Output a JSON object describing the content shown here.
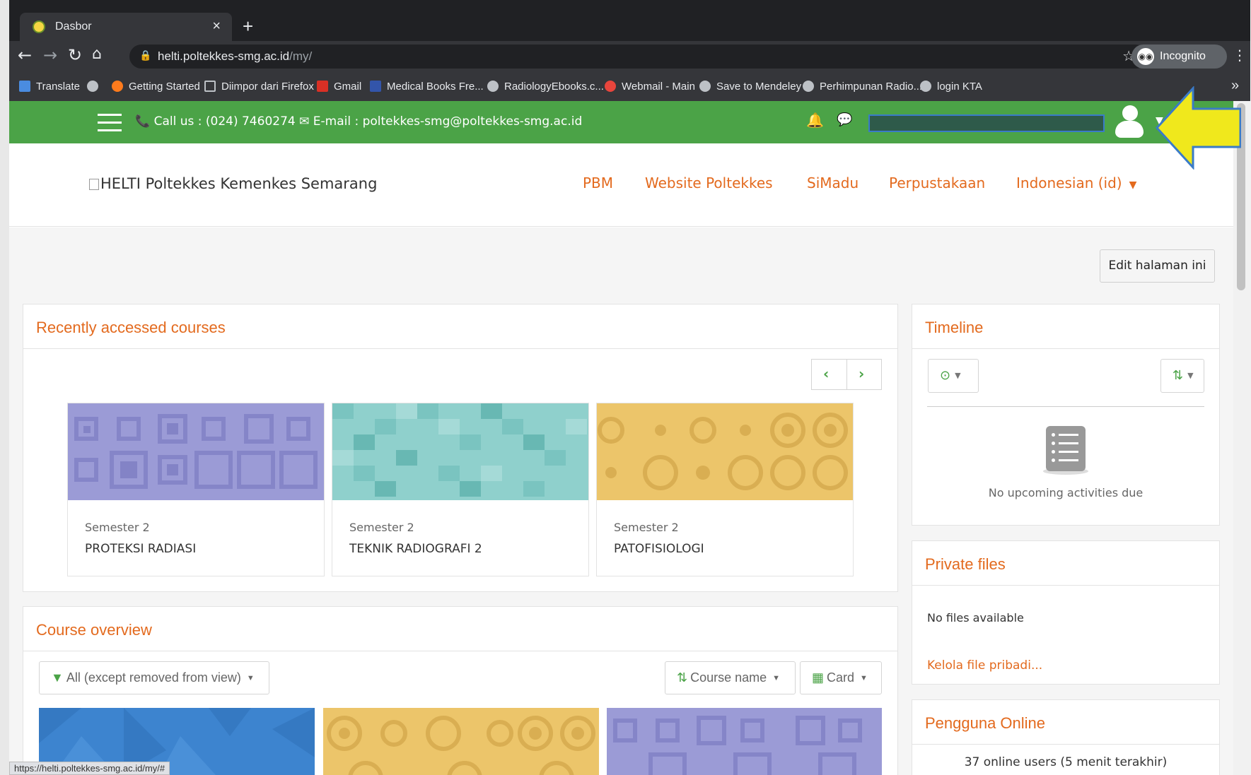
{
  "browser": {
    "tab_title": "Dasbor",
    "tab_close": "×",
    "new_tab": "+",
    "url_host": "helti.poltekkes-smg.ac.id",
    "url_path": "/my/",
    "incognito_label": "Incognito",
    "bookmarks": [
      "Translate",
      "Getting Started",
      "Diimpor dari Firefox",
      "Gmail",
      "Medical Books Fre...",
      "RadiologyEbooks.c...",
      "Webmail - Main",
      "Save to Mendeley",
      "Perhimpunan Radio...",
      "login KTA"
    ],
    "bookmarks_more": "»",
    "status_url": "https://helti.poltekkes-smg.ac.id/my/#"
  },
  "topbar": {
    "contact": "📞 Call us : (024) 7460274 ✉ E-mail : poltekkes-smg@poltekkes-smg.ac.id",
    "color": "#4ba347"
  },
  "header": {
    "logo_alt": "HELTI Poltekkes Kemenkes Semarang",
    "nav": [
      "PBM",
      "Website Poltekkes",
      "SiMadu",
      "Perpustakaan",
      "Indonesian (id)"
    ]
  },
  "page": {
    "edit_button": "Edit halaman ini"
  },
  "recent": {
    "title": "Recently accessed courses",
    "courses": [
      {
        "category": "Semester 2",
        "name": "PROTEKSI RADIASI",
        "pattern": "purple-squares"
      },
      {
        "category": "Semester 2",
        "name": "TEKNIK RADIOGRAFI 2",
        "pattern": "teal-grid"
      },
      {
        "category": "Semester 2",
        "name": "PATOFISIOLOGI",
        "pattern": "yellow-circles"
      }
    ]
  },
  "overview": {
    "title": "Course overview",
    "filter_label": "All (except removed from view)",
    "sort_label": "Course name",
    "view_label": "Card"
  },
  "timeline": {
    "title": "Timeline",
    "empty_text": "No upcoming activities due"
  },
  "private_files": {
    "title": "Private files",
    "empty_text": "No files available",
    "manage_link": "Kelola file pribadi..."
  },
  "online_users": {
    "title": "Pengguna Online",
    "text": "37 online users (5 menit terakhir)"
  },
  "colors": {
    "accent": "#e36a1e",
    "green": "#4ba347",
    "arrow": "#f0e81c"
  }
}
